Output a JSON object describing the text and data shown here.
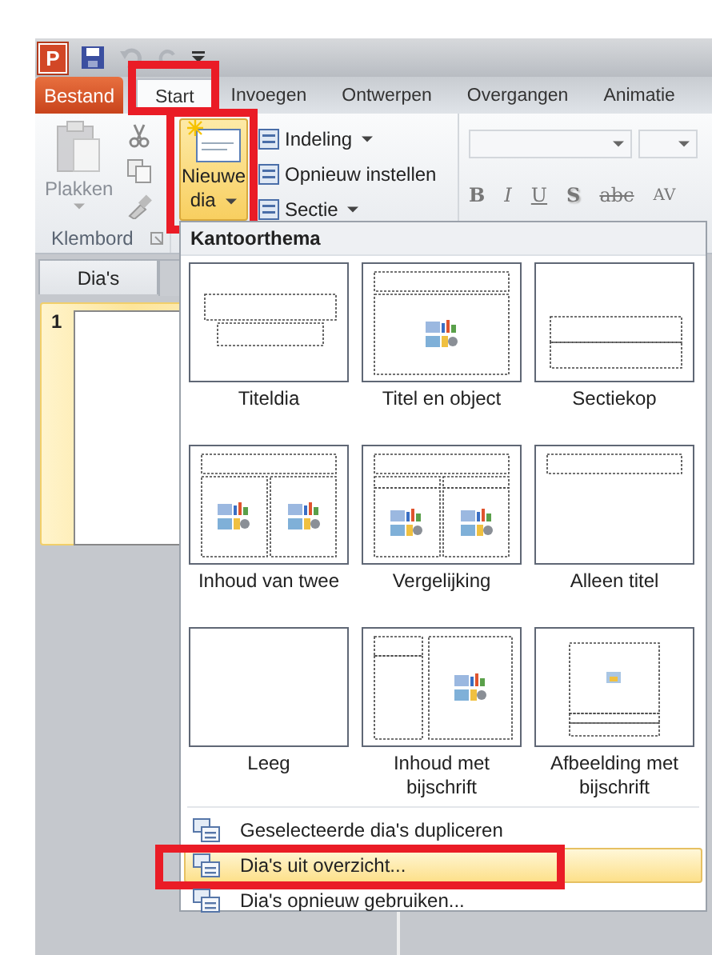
{
  "quick_access": {
    "logo": "P"
  },
  "file_tab": "Bestand",
  "tabs": [
    {
      "label": "Start",
      "selected": true,
      "highlighted": true
    },
    {
      "label": "Invoegen",
      "selected": false,
      "highlighted": false
    },
    {
      "label": "Ontwerpen",
      "selected": false,
      "highlighted": false
    },
    {
      "label": "Overgangen",
      "selected": false,
      "highlighted": false
    },
    {
      "label": "Animatie",
      "selected": false,
      "highlighted": false
    }
  ],
  "clipboard": {
    "paste_label": "Plakken",
    "paste_disabled": true,
    "group_label": "Klembord"
  },
  "new_slide": {
    "label_lines": [
      "Nieuwe",
      "dia"
    ],
    "hovered": true,
    "highlighted": true
  },
  "slide_commands": [
    {
      "label": "Indeling",
      "dropdown": true
    },
    {
      "label": "Opnieuw instellen",
      "dropdown": false
    },
    {
      "label": "Sectie",
      "dropdown": true
    }
  ],
  "format_buttons": [
    {
      "label": "B",
      "kind": "bold"
    },
    {
      "label": "I",
      "kind": "italic"
    },
    {
      "label": "U",
      "kind": "underline"
    },
    {
      "label": "S",
      "kind": "shadow"
    },
    {
      "label": "abc",
      "kind": "strike"
    },
    {
      "label": "AV",
      "kind": "spacing"
    }
  ],
  "pane": {
    "tabs": [
      {
        "label": "Dia's",
        "selected": true
      }
    ],
    "slides": [
      {
        "number": "1",
        "selected": true
      }
    ]
  },
  "gallery": {
    "title": "Kantoorthema",
    "layouts": [
      {
        "label": "Titeldia",
        "kind": "title"
      },
      {
        "label": "Titel en object",
        "kind": "title-content"
      },
      {
        "label": "Sectiekop",
        "kind": "section"
      },
      {
        "label": "Inhoud van twee",
        "kind": "two-content"
      },
      {
        "label": "Vergelijking",
        "kind": "comparison"
      },
      {
        "label": "Alleen titel",
        "kind": "title-only"
      },
      {
        "label": "Leeg",
        "kind": "blank"
      },
      {
        "label": "Inhoud met bijschrift",
        "kind": "content-caption"
      },
      {
        "label": "Afbeelding met bijschrift",
        "kind": "picture-caption"
      }
    ],
    "items": [
      {
        "label": "Geselecteerde dia's dupliceren",
        "hovered": false,
        "highlighted": false
      },
      {
        "label": "Dia's uit overzicht...",
        "hovered": true,
        "highlighted": true
      },
      {
        "label": "Dia's opnieuw gebruiken...",
        "hovered": false,
        "highlighted": false
      }
    ]
  }
}
